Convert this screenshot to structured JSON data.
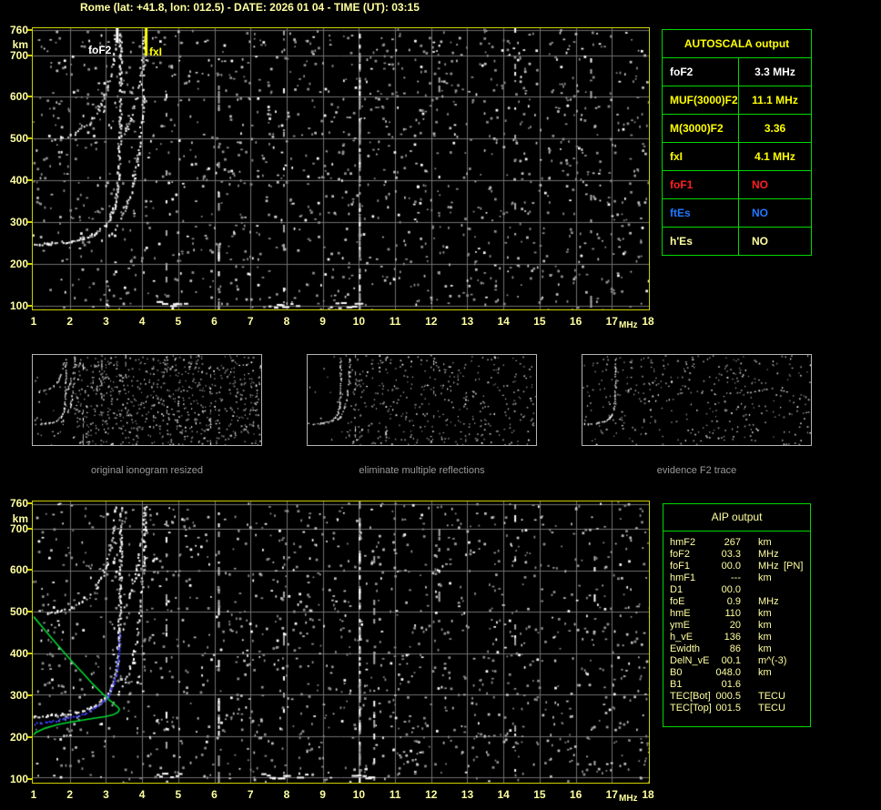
{
  "title": "Rome (lat: +41.8, lon: 012.5) - DATE: 2026 01 04 - TIME (UT): 03:15",
  "colors": {
    "background": "#000000",
    "pale_yellow": "#ffffa0",
    "bright_yellow": "#ffff00",
    "plot_border": "#cfcf00",
    "table_border": "#00d800",
    "grid": "#6f6f6f",
    "red": "#ff2020",
    "blue": "#2277ff",
    "white": "#ffffff",
    "green_profile": "#00d830",
    "blue_trace": "#3b3bff",
    "panel_border": "#b4b4b4",
    "caption_gray": "#9a9a9a"
  },
  "autoscala_table": {
    "header": "AUTOSCALA output",
    "rows": [
      {
        "label": "foF2",
        "value": "3.3 MHz",
        "color": "#ffffff"
      },
      {
        "label": "MUF(3000)F2",
        "value": "11.1 MHz",
        "color": "#ffff00"
      },
      {
        "label": "M(3000)F2",
        "value": "3.36",
        "color": "#ffff00"
      },
      {
        "label": "fxI",
        "value": "4.1 MHz",
        "color": "#ffff00"
      },
      {
        "label": "foF1",
        "value": "NO",
        "color": "#ff2020"
      },
      {
        "label": "ftEs",
        "value": "NO",
        "color": "#2277ff"
      },
      {
        "label": "h'Es",
        "value": "NO",
        "color": "#ffffa0"
      }
    ]
  },
  "aip_table": {
    "header": "AIP output",
    "rows": [
      {
        "label": "hmF2",
        "value": "267",
        "unit": "km",
        "extra": ""
      },
      {
        "label": "foF2",
        "value": "03.3",
        "unit": "MHz",
        "extra": ""
      },
      {
        "label": "foF1",
        "value": "00.0",
        "unit": "MHz",
        "extra": "[PN]"
      },
      {
        "label": "hmF1",
        "value": "---",
        "unit": "km",
        "extra": ""
      },
      {
        "label": "D1",
        "value": "00.0",
        "unit": "",
        "extra": ""
      },
      {
        "label": "foE",
        "value": "0.9",
        "unit": "MHz",
        "extra": ""
      },
      {
        "label": "hmE",
        "value": "110",
        "unit": "km",
        "extra": ""
      },
      {
        "label": "ymE",
        "value": "20",
        "unit": "km",
        "extra": ""
      },
      {
        "label": "h_vE",
        "value": "136",
        "unit": "km",
        "extra": ""
      },
      {
        "label": "Ewidth",
        "value": "86",
        "unit": "km",
        "extra": ""
      },
      {
        "label": "DelN_vE",
        "value": "00.1",
        "unit": "m^(-3)",
        "extra": ""
      },
      {
        "label": "B0",
        "value": "048.0",
        "unit": "km",
        "extra": ""
      },
      {
        "label": "B1",
        "value": "01.6",
        "unit": "",
        "extra": ""
      },
      {
        "label": "TEC[Bot]",
        "value": "000.5",
        "unit": "TECU",
        "extra": ""
      },
      {
        "label": "TEC[Top]",
        "value": "001.5",
        "unit": "TECU",
        "extra": ""
      }
    ]
  },
  "panels": [
    {
      "caption": "original ionogram resized",
      "noise_dots": 950,
      "quiet_left": true,
      "series_idx": [
        0,
        1,
        2,
        3
      ],
      "stripes": [
        {
          "f": 4.7,
          "p": 0.22
        },
        {
          "f": 6.1,
          "p": 0.28
        },
        {
          "f": 7.9,
          "p": 0.22
        },
        {
          "f": 10.0,
          "p": 0.32
        },
        {
          "f": 11.0,
          "p": 0.18
        },
        {
          "f": 14.3,
          "p": 0.14
        }
      ],
      "seed": 101
    },
    {
      "caption": "eliminate multiple reflections",
      "noise_dots": 520,
      "quiet_left": true,
      "series_idx": [
        0,
        1
      ],
      "stripes": [
        {
          "f": 4.5,
          "p": 0.12
        },
        {
          "f": 6.8,
          "p": 0.2
        },
        {
          "f": 10.4,
          "p": 0.22
        }
      ],
      "seed": 202
    },
    {
      "caption": "evidence F2 trace",
      "noise_dots": 400,
      "quiet_left": false,
      "series_idx": [
        0
      ],
      "stripes": [],
      "seed": 303
    }
  ],
  "chart_data": [
    {
      "type": "scatter",
      "title": "",
      "xlabel": "MHz",
      "ylabel": "km",
      "xlim": [
        1,
        18
      ],
      "ylim": [
        100,
        760
      ],
      "x_ticks": [
        1,
        2,
        3,
        4,
        5,
        6,
        7,
        8,
        9,
        10,
        11,
        12,
        13,
        14,
        15,
        16,
        17,
        18
      ],
      "y_ticks": [
        760,
        700,
        600,
        500,
        400,
        300,
        200,
        100
      ],
      "grid": true,
      "legend": "none",
      "markers": [
        {
          "label": "foF2",
          "freq_mhz": 3.3,
          "color": "#ffffff",
          "line_len": 16
        },
        {
          "label": "fxI",
          "freq_mhz": 4.1,
          "color": "#ffff00",
          "line_len": 30
        }
      ],
      "series": [
        {
          "name": "F2 trace O-mode 1st hop",
          "color": "#ffffff",
          "prob": 0.9,
          "size": 2,
          "points": [
            [
              1.0,
              249
            ],
            [
              1.3,
              250
            ],
            [
              1.6,
              252
            ],
            [
              1.9,
              255
            ],
            [
              2.2,
              259
            ],
            [
              2.45,
              265
            ],
            [
              2.65,
              273
            ],
            [
              2.85,
              284
            ],
            [
              3.0,
              298
            ],
            [
              3.1,
              312
            ],
            [
              3.18,
              330
            ],
            [
              3.25,
              355
            ],
            [
              3.3,
              385
            ],
            [
              3.33,
              420
            ],
            [
              3.35,
              460
            ],
            [
              3.37,
              510
            ],
            [
              3.38,
              570
            ],
            [
              3.39,
              640
            ],
            [
              3.39,
              760
            ]
          ]
        },
        {
          "name": "F2 trace X-mode 1st hop",
          "color": "#ffffff",
          "prob": 0.6,
          "size": 2,
          "points": [
            [
              3.1,
              270
            ],
            [
              3.25,
              288
            ],
            [
              3.4,
              310
            ],
            [
              3.55,
              338
            ],
            [
              3.68,
              372
            ],
            [
              3.78,
              410
            ],
            [
              3.86,
              450
            ],
            [
              3.93,
              500
            ],
            [
              3.99,
              560
            ],
            [
              4.03,
              630
            ],
            [
              4.06,
              700
            ],
            [
              4.08,
              760
            ]
          ]
        },
        {
          "name": "F2 trace O-mode 2nd hop",
          "color": "#e0e0e0",
          "prob": 0.6,
          "size": 2,
          "points": [
            [
              1.35,
              498
            ],
            [
              1.6,
              501
            ],
            [
              1.85,
              506
            ],
            [
              2.1,
              514
            ],
            [
              2.35,
              527
            ],
            [
              2.55,
              543
            ],
            [
              2.75,
              565
            ],
            [
              2.9,
              592
            ],
            [
              3.02,
              622
            ],
            [
              3.12,
              658
            ],
            [
              3.2,
              700
            ],
            [
              3.26,
              760
            ]
          ]
        },
        {
          "name": "F2 trace X-mode 2nd hop",
          "color": "#e0e0e0",
          "prob": 0.5,
          "size": 2,
          "points": [
            [
              3.5,
              512
            ],
            [
              3.62,
              536
            ],
            [
              3.73,
              565
            ],
            [
              3.83,
              600
            ],
            [
              3.91,
              640
            ],
            [
              3.98,
              685
            ],
            [
              4.03,
              730
            ],
            [
              4.06,
              760
            ]
          ]
        }
      ],
      "interference_lines": [
        {
          "f": 4.65,
          "p": 0.1
        },
        {
          "f": 6.1,
          "p": 0.2
        },
        {
          "f": 7.9,
          "p": 0.13
        },
        {
          "f": 10.0,
          "p": 0.5
        },
        {
          "f": 12.2,
          "p": 0.07
        },
        {
          "f": 14.3,
          "p": 0.09
        },
        {
          "f": 16.4,
          "p": 0.05
        }
      ],
      "echo_clusters": [
        {
          "f0": 4.4,
          "f1": 5.3,
          "h": 107
        },
        {
          "f0": 7.5,
          "f1": 8.4,
          "h": 104
        },
        {
          "f0": 9.2,
          "f1": 10.1,
          "h": 103
        }
      ],
      "noise_dots": 1500,
      "noise_seed": 13
    },
    {
      "type": "scatter",
      "title": "",
      "xlabel": "MHz",
      "ylabel": "km",
      "xlim": [
        1,
        18
      ],
      "ylim": [
        100,
        760
      ],
      "x_ticks": [
        1,
        2,
        3,
        4,
        5,
        6,
        7,
        8,
        9,
        10,
        11,
        12,
        13,
        14,
        15,
        16,
        17,
        18
      ],
      "y_ticks": [
        760,
        700,
        600,
        500,
        400,
        300,
        200,
        100
      ],
      "grid": true,
      "legend": "none",
      "markers": [],
      "series": [
        {
          "name": "F2 trace O-mode 1st hop",
          "color": "#ffffff",
          "prob": 0.9,
          "size": 2,
          "points": [
            [
              1.0,
              249
            ],
            [
              1.3,
              250
            ],
            [
              1.6,
              252
            ],
            [
              1.9,
              255
            ],
            [
              2.2,
              259
            ],
            [
              2.45,
              265
            ],
            [
              2.65,
              273
            ],
            [
              2.85,
              284
            ],
            [
              3.0,
              298
            ],
            [
              3.1,
              312
            ],
            [
              3.18,
              330
            ],
            [
              3.25,
              355
            ],
            [
              3.3,
              385
            ],
            [
              3.33,
              420
            ],
            [
              3.35,
              460
            ],
            [
              3.37,
              510
            ],
            [
              3.38,
              570
            ],
            [
              3.39,
              640
            ],
            [
              3.39,
              760
            ]
          ]
        },
        {
          "name": "F2 trace X-mode 1st hop",
          "color": "#ffffff",
          "prob": 0.6,
          "size": 2,
          "points": [
            [
              3.1,
              270
            ],
            [
              3.25,
              288
            ],
            [
              3.4,
              310
            ],
            [
              3.55,
              338
            ],
            [
              3.68,
              372
            ],
            [
              3.78,
              410
            ],
            [
              3.86,
              450
            ],
            [
              3.93,
              500
            ],
            [
              3.99,
              560
            ],
            [
              4.03,
              630
            ],
            [
              4.06,
              700
            ],
            [
              4.08,
              760
            ]
          ]
        },
        {
          "name": "F2 trace O-mode 2nd hop",
          "color": "#e0e0e0",
          "prob": 0.6,
          "size": 2,
          "points": [
            [
              1.35,
              498
            ],
            [
              1.6,
              501
            ],
            [
              1.85,
              506
            ],
            [
              2.1,
              514
            ],
            [
              2.35,
              527
            ],
            [
              2.55,
              543
            ],
            [
              2.75,
              565
            ],
            [
              2.9,
              592
            ],
            [
              3.02,
              622
            ],
            [
              3.12,
              658
            ],
            [
              3.2,
              700
            ],
            [
              3.26,
              760
            ]
          ]
        },
        {
          "name": "F2 trace X-mode 2nd hop",
          "color": "#e0e0e0",
          "prob": 0.5,
          "size": 2,
          "points": [
            [
              3.5,
              512
            ],
            [
              3.62,
              536
            ],
            [
              3.73,
              565
            ],
            [
              3.83,
              600
            ],
            [
              3.91,
              640
            ],
            [
              3.98,
              685
            ],
            [
              4.03,
              730
            ],
            [
              4.06,
              760
            ]
          ]
        }
      ],
      "interference_lines": [
        {
          "f": 4.65,
          "p": 0.09
        },
        {
          "f": 6.1,
          "p": 0.18
        },
        {
          "f": 7.9,
          "p": 0.12
        },
        {
          "f": 10.0,
          "p": 0.5
        },
        {
          "f": 10.4,
          "p": 0.15
        },
        {
          "f": 12.2,
          "p": 0.07
        },
        {
          "f": 14.3,
          "p": 0.08
        },
        {
          "f": 16.5,
          "p": 0.05
        }
      ],
      "echo_clusters": [
        {
          "f0": 7.3,
          "f1": 8.6,
          "h": 104
        },
        {
          "f0": 9.8,
          "f1": 10.3,
          "h": 103
        },
        {
          "f0": 4.4,
          "f1": 5.1,
          "h": 107
        }
      ],
      "noise_dots": 1500,
      "noise_seed": 29,
      "overlays": {
        "electron_density_profile_green": [
          [
            1.0,
            488
          ],
          [
            1.25,
            462
          ],
          [
            1.5,
            436
          ],
          [
            1.8,
            406
          ],
          [
            2.1,
            376
          ],
          [
            2.4,
            348
          ],
          [
            2.65,
            324
          ],
          [
            2.9,
            302
          ],
          [
            3.1,
            286
          ],
          [
            3.25,
            275
          ],
          [
            3.35,
            268
          ],
          [
            3.37,
            263
          ],
          [
            3.33,
            257
          ],
          [
            3.2,
            251
          ],
          [
            3.0,
            247
          ],
          [
            2.7,
            243
          ],
          [
            2.35,
            238
          ],
          [
            2.0,
            233
          ],
          [
            1.65,
            227
          ],
          [
            1.3,
            218
          ],
          [
            1.05,
            208
          ],
          [
            1.0,
            202
          ]
        ],
        "fitted_trace_blue": [
          [
            1.0,
            231
          ],
          [
            1.3,
            234
          ],
          [
            1.6,
            238
          ],
          [
            1.9,
            243
          ],
          [
            2.2,
            250
          ],
          [
            2.45,
            258
          ],
          [
            2.65,
            266
          ],
          [
            2.85,
            278
          ],
          [
            3.0,
            292
          ],
          [
            3.1,
            306
          ],
          [
            3.18,
            324
          ],
          [
            3.25,
            346
          ],
          [
            3.3,
            372
          ],
          [
            3.33,
            400
          ],
          [
            3.36,
            428
          ],
          [
            3.38,
            452
          ]
        ]
      }
    }
  ]
}
